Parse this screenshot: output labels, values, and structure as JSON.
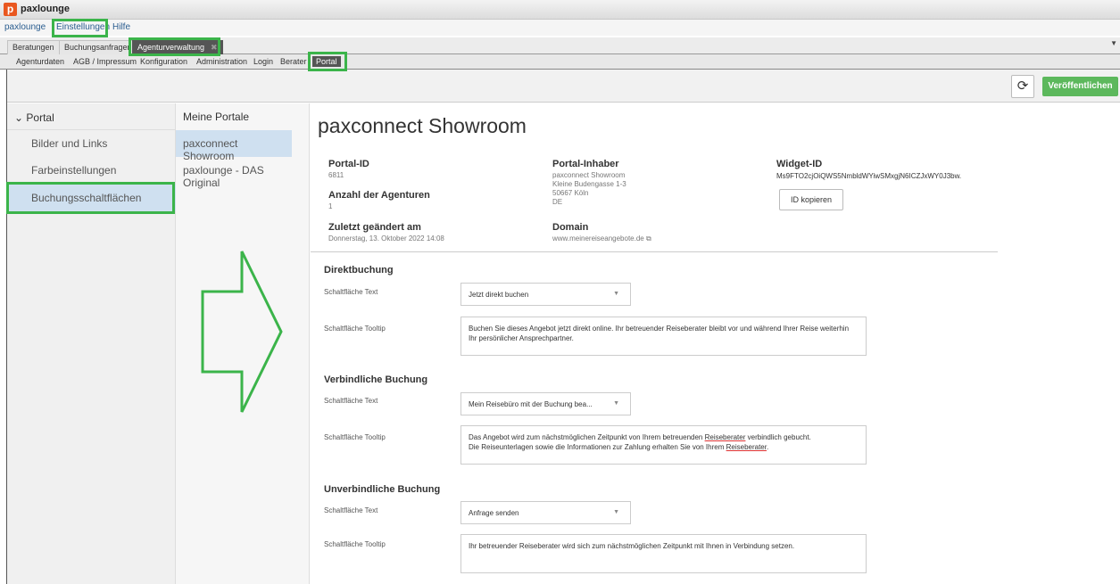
{
  "app": {
    "logo_letter": "p",
    "title": "paxlounge"
  },
  "menu": {
    "items": [
      "paxlounge",
      "Einstellungen",
      "Hilfe"
    ]
  },
  "tabs_main": {
    "items": [
      "Beratungen",
      "Buchungsanfragen",
      "Agenturverwaltung"
    ],
    "active": "Agenturverwaltung",
    "close_glyph": "✖",
    "overflow_glyph": "▼"
  },
  "tabs_sub": {
    "items": [
      "Agenturdaten",
      "AGB / Impressum",
      "Konfiguration",
      "Administration",
      "Login",
      "Berater",
      "Portal"
    ],
    "active": "Portal"
  },
  "toolbar": {
    "refresh_icon": "⟳",
    "publish_label": "Veröffentlichen"
  },
  "sidebar": {
    "header": "Portal",
    "header_icon": "⌄",
    "items": [
      "Bilder und Links",
      "Farbeinstellungen",
      "Buchungsschaltflächen"
    ],
    "selected": "Buchungsschaltflächen"
  },
  "portal_list": {
    "header": "Meine Portale",
    "items": [
      "paxconnect Showroom",
      "paxlounge - DAS Original"
    ],
    "selected": "paxconnect Showroom"
  },
  "portal": {
    "title": "paxconnect Showroom",
    "id_label": "Portal-ID",
    "id_value": "6811",
    "agencies_label": "Anzahl der Agenturen",
    "agencies_value": "1",
    "changed_label": "Zuletzt geändert am",
    "changed_value": "Donnerstag, 13. Oktober 2022 14:08",
    "owner_label": "Portal-Inhaber",
    "owner_lines": [
      "paxconnect Showroom",
      "Kleine Budengasse 1-3",
      "50667 Köln",
      "DE"
    ],
    "domain_label": "Domain",
    "domain_value": "www.meinereiseangebote.de",
    "widget_label": "Widget-ID",
    "widget_value": "Ms9FTO2cjOiQWS5NmbldWYiwSMxgjN6ICZJxWY0J3bw.",
    "copy_label": "ID kopieren"
  },
  "sections": [
    {
      "title": "Direktbuchung",
      "text_label": "Schaltfläche Text",
      "text_value": "Jetzt direkt buchen",
      "tooltip_label": "Schaltfläche Tooltip",
      "tooltip_value": "Buchen Sie dieses Angebot jetzt direkt online. Ihr betreuender Reiseberater bleibt vor und während Ihrer Reise weiterhin Ihr persönlicher Ansprechpartner."
    },
    {
      "title": "Verbindliche Buchung",
      "text_label": "Schaltfläche Text",
      "text_value": "Mein Reisebüro mit der Buchung bea...",
      "tooltip_label": "Schaltfläche Tooltip",
      "tooltip_line1_a": "Das Angebot wird zum nächstmöglichen Zeitpunkt von Ihrem betreuenden ",
      "tooltip_line1_u": "Reiseberater",
      "tooltip_line1_b": " verbindlich gebucht.",
      "tooltip_line2_a": "Die Reiseunterlagen sowie die Informationen zur Zahlung erhalten Sie von Ihrem ",
      "tooltip_line2_u": "Reiseberater",
      "tooltip_line2_b": "."
    },
    {
      "title": "Unverbindliche Buchung",
      "text_label": "Schaltfläche Text",
      "text_value": "Anfrage senden",
      "tooltip_label": "Schaltfläche Tooltip",
      "tooltip_value": "Ihr betreuender Reiseberater wird sich zum nächstmöglichen Zeitpunkt mit Ihnen in Verbindung setzen."
    }
  ],
  "icons": {
    "external_link": "⧉",
    "dropdown": "▼"
  },
  "colors": {
    "highlight": "#3bb44a",
    "publish": "#5cb85c",
    "selected": "#cfe0f0"
  }
}
